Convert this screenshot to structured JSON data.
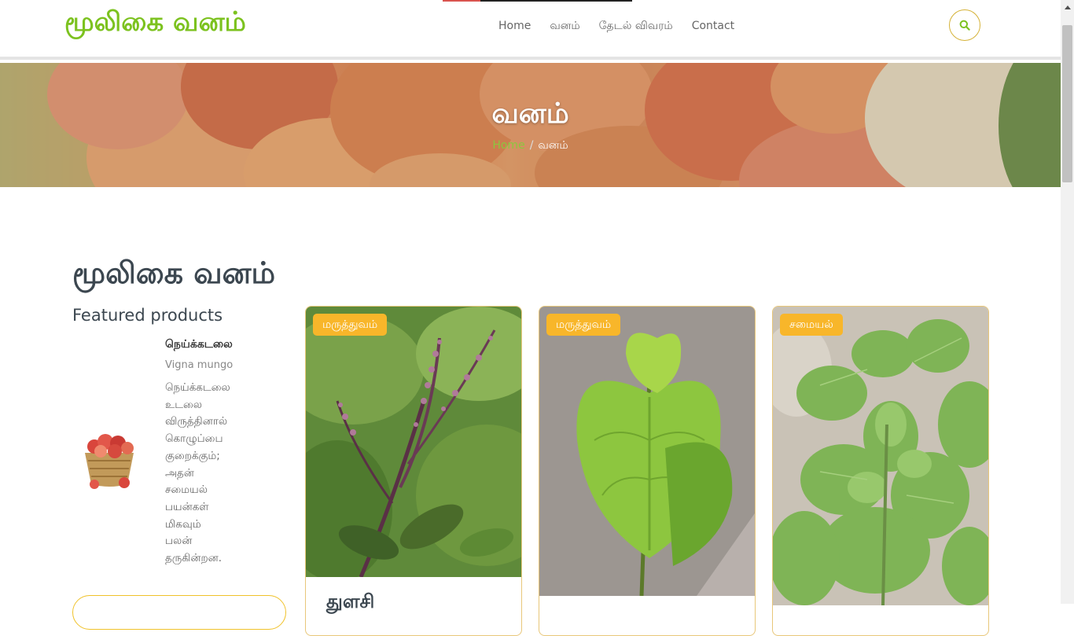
{
  "header": {
    "logo": "மூலிகை வனம்",
    "nav": [
      "Home",
      "வனம்",
      "தேடல் விவரம்",
      "Contact"
    ],
    "search_icon": "search-icon"
  },
  "hero": {
    "title": "வனம்",
    "breadcrumb": {
      "home": "Home",
      "separator": "/",
      "current": "வனம்"
    }
  },
  "main": {
    "title": "மூலிகை வனம்",
    "sidebar": {
      "title": "Featured products",
      "product": {
        "name": "நெய்க்கடலை",
        "scientific": "Vigna mungo",
        "description_lines": [
          "நெய்க்கடலை",
          "உடலை",
          "விருத்தினால்",
          "கொழுப்பை",
          "குறைக்கும்;",
          "அதன்",
          "சமையல்",
          "பயன்கள்",
          "மிகவும்",
          "பலன்",
          "தருகின்றன."
        ]
      }
    },
    "cards": [
      {
        "badge": "மருத்துவம்",
        "title": "துளசி"
      },
      {
        "badge": "மருத்துவம்",
        "title": ""
      },
      {
        "badge": "சமையல்",
        "title": ""
      }
    ]
  },
  "colors": {
    "accent_green": "#7cc21f",
    "badge": "#f8b62a",
    "heading": "#3c4750",
    "breadcrumb_home": "#8cc63f"
  }
}
